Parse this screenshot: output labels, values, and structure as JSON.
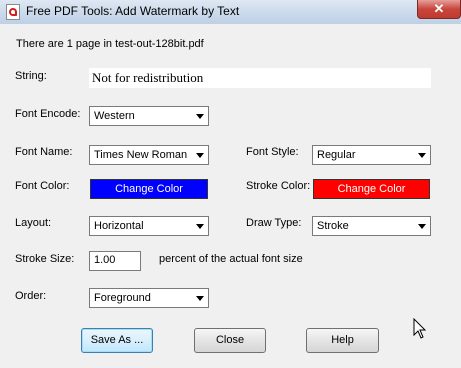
{
  "window": {
    "title": "Free PDF Tools: Add Watermark by Text",
    "close_glyph": "✕"
  },
  "info": {
    "page_count_text": "There are 1 page in test-out-128bit.pdf"
  },
  "form": {
    "string_label": "String:",
    "string_value": "Not for redistribution",
    "font_encode_label": "Font Encode:",
    "font_encode_value": "Western",
    "font_name_label": "Font Name:",
    "font_name_value": "Times New Roman",
    "font_style_label": "Font Style:",
    "font_style_value": "Regular",
    "font_color_label": "Font Color:",
    "font_color_button": "Change Color",
    "font_color": "#0000ff",
    "stroke_color_label": "Stroke Color:",
    "stroke_color_button": "Change Color",
    "stroke_color": "#ff0000",
    "layout_label": "Layout:",
    "layout_value": "Horizontal",
    "draw_type_label": "Draw Type:",
    "draw_type_value": "Stroke",
    "stroke_size_label": "Stroke Size:",
    "stroke_size_value": "1.00",
    "stroke_size_suffix": "percent of the actual font size",
    "order_label": "Order:",
    "order_value": "Foreground"
  },
  "buttons": {
    "save_as": "Save As ...",
    "close": "Close",
    "help": "Help"
  },
  "icons": {
    "app": "pdf-app-icon",
    "cursor": "mouse-pointer-icon"
  }
}
